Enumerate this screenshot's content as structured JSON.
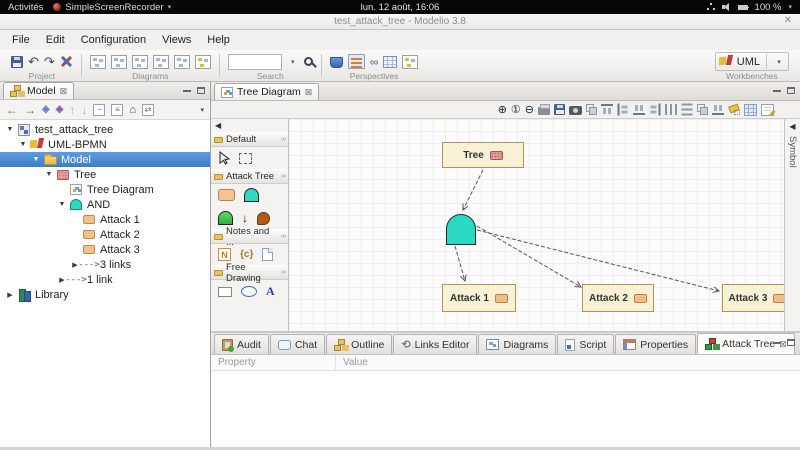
{
  "system_bar": {
    "activities_label": "Activités",
    "app_name": "SimpleScreenRecorder",
    "clock": "lun. 12 août, 16:06",
    "battery_label": "100 %"
  },
  "titlebar": {
    "title": "test_attack_tree - Modelio 3.8"
  },
  "menus": [
    {
      "label": "File"
    },
    {
      "label": "Edit"
    },
    {
      "label": "Configuration"
    },
    {
      "label": "Views"
    },
    {
      "label": "Help"
    }
  ],
  "toolbar": {
    "project_label": "Project",
    "diagrams_label": "Diagrams",
    "search_label": "Search",
    "perspectives_label": "Perspectives",
    "workbenches_label": "Workbenches",
    "workbench_value": "UML"
  },
  "model_panel": {
    "tab_label": "Model",
    "link_arrow_glyph": "--->",
    "items": [
      {
        "label": "test_attack_tree"
      },
      {
        "label": "UML-BPMN"
      },
      {
        "label": "Model"
      },
      {
        "label": "Tree"
      },
      {
        "label": "Tree Diagram"
      },
      {
        "label": "AND"
      },
      {
        "label": "Attack 1"
      },
      {
        "label": "Attack 2"
      },
      {
        "label": "Attack 3"
      },
      {
        "label": "3 links"
      },
      {
        "label": "1 link"
      },
      {
        "label": "Library"
      }
    ]
  },
  "diagram": {
    "tab_label": "Tree Diagram",
    "symbol_tab_label": "Symbol",
    "palette": {
      "sections": [
        {
          "label": "Default"
        },
        {
          "label": "Attack Tree"
        },
        {
          "label": "Notes and ..."
        },
        {
          "label": "Free Drawing"
        }
      ],
      "note_glyph": "N",
      "constraint_glyph": "{c}",
      "text_tool_glyph": "A"
    },
    "nodes": [
      {
        "label": "Tree"
      },
      {
        "label": "Attack 1"
      },
      {
        "label": "Attack 2"
      },
      {
        "label": "Attack 3"
      }
    ]
  },
  "bottom_panel": {
    "tabs": [
      {
        "label": "Audit"
      },
      {
        "label": "Chat"
      },
      {
        "label": "Outline"
      },
      {
        "label": "Links Editor"
      },
      {
        "label": "Diagrams"
      },
      {
        "label": "Script"
      },
      {
        "label": "Properties"
      },
      {
        "label": "Attack Tree"
      }
    ],
    "active_tab": "Attack Tree",
    "table": {
      "columns": [
        {
          "label": "Property"
        },
        {
          "label": "Value"
        }
      ]
    }
  },
  "colors": {
    "selection_blue": "#4a88d2",
    "and_gate_teal": "#2bd8c3",
    "node_fill": "#f8f1d5",
    "node_border": "#a89858",
    "attack_icon_orange": "#f2bc82",
    "tree_icon_pink": "#e4a0a0"
  }
}
